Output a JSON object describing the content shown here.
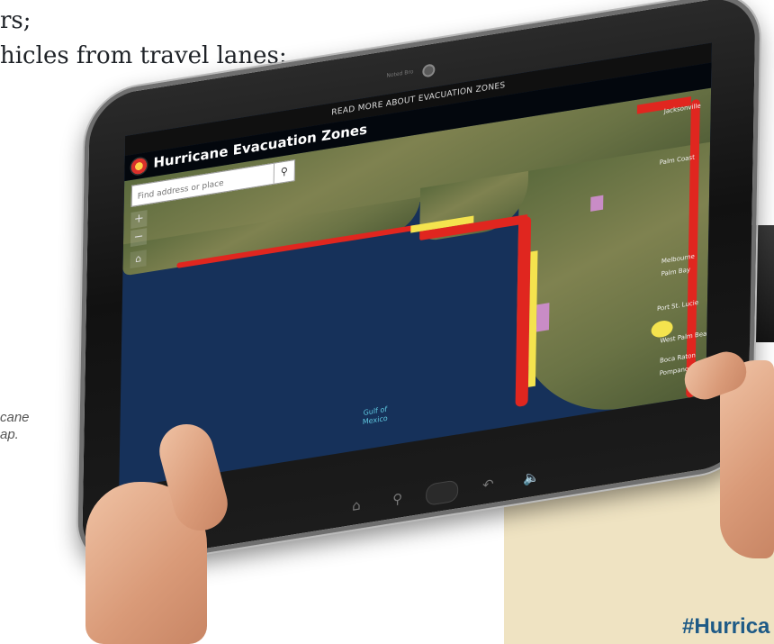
{
  "document": {
    "line1": "rs;",
    "line2": "hicles from travel lanes;",
    "caption_line1": "cane",
    "caption_line2": "ap.",
    "hashtag": "#Hurrica"
  },
  "tablet": {
    "camera_label": "Noted  Bro"
  },
  "app": {
    "top_link": "READ MORE ABOUT EVACUATION ZONES",
    "title": "Hurricane Evacuation Zones",
    "search": {
      "placeholder": "Find address or place",
      "icon": "search-icon"
    },
    "zoom_in": "+",
    "zoom_out": "−",
    "home": "⌂",
    "water_label": "Gulf of\nMexico",
    "cities": [
      "Jacksonville",
      "Palm Coast",
      "Melbourne",
      "Palm Bay",
      "Port St. Lucie",
      "West Palm Beach",
      "Boca Raton",
      "Pompano"
    ],
    "legend_colors": {
      "zone_a": "#e0261f",
      "zone_b": "#f4e34e",
      "zone_c": "#c98cc6",
      "water": "#16315a"
    }
  },
  "nav": {
    "home_icon": "house-icon",
    "search_icon": "search-icon",
    "back_icon": "back-arrow-icon",
    "volume_icon": "volume-icon"
  }
}
